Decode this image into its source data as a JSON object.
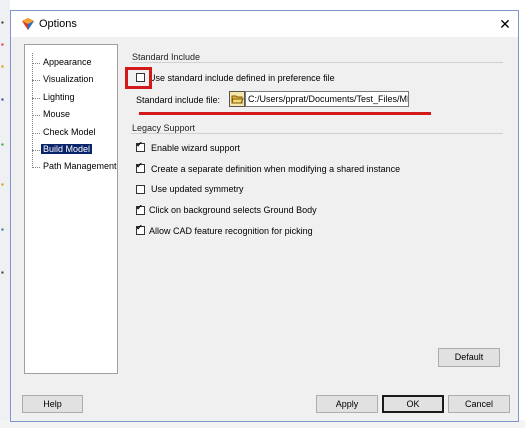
{
  "window": {
    "title": "Options",
    "close_symbol": "✕"
  },
  "sidebar": {
    "items": [
      {
        "label": "Appearance"
      },
      {
        "label": "Visualization"
      },
      {
        "label": "Lighting"
      },
      {
        "label": "Mouse"
      },
      {
        "label": "Check Model"
      },
      {
        "label": "Build Model"
      },
      {
        "label": "Path Management"
      }
    ],
    "selected_index": 5
  },
  "standard_include": {
    "group_title": "Standard Include",
    "use_checkbox_label": "Use standard include defined in preference file",
    "use_checked": false,
    "file_label": "Standard include file:",
    "file_value": "C:/Users/pprat/Documents/Test_Files/MD"
  },
  "legacy_support": {
    "group_title": "Legacy Support",
    "options": [
      {
        "label": "Enable wizard support",
        "checked": true
      },
      {
        "label": "Create a separate definition when modifying a shared instance",
        "checked": true
      },
      {
        "label": "Use updated symmetry",
        "checked": false
      },
      {
        "label": "Click on background selects Ground Body",
        "checked": true
      },
      {
        "label": "Allow CAD feature recognition for picking",
        "checked": true
      }
    ]
  },
  "buttons": {
    "default": "Default",
    "help": "Help",
    "apply": "Apply",
    "ok": "OK",
    "cancel": "Cancel"
  },
  "colors": {
    "annotation": "#d21a1a",
    "selection": "#0a246a"
  }
}
